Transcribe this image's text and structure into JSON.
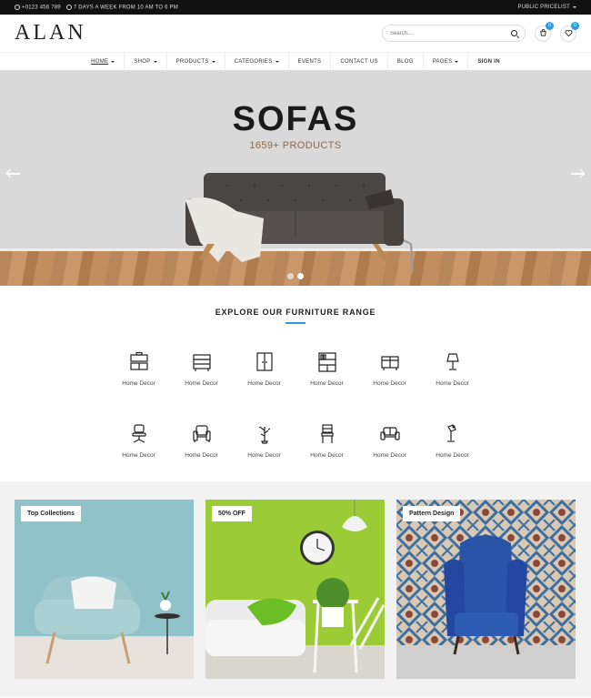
{
  "topbar": {
    "phone": "+0123 456 789",
    "hours": "7 DAYS A WEEK FROM 10 AM TO 6 PM",
    "pricelist": "PUBLIC PRICELIST"
  },
  "header": {
    "logo": "ALAN",
    "search_placeholder": "Search...",
    "cart_count": "0",
    "wishlist_count": "0"
  },
  "nav": {
    "items": [
      "HOME",
      "SHOP",
      "PRODUCTS",
      "CATEGORIES",
      "EVENTS",
      "CONTACT US",
      "BLOG",
      "PAGES",
      "SIGN IN"
    ]
  },
  "hero": {
    "title": "SOFAS",
    "subtitle": "1659+ PRODUCTS"
  },
  "range": {
    "title": "EXPLORE OUR FURNITURE RANGE",
    "categories": [
      {
        "label": "Home Decor",
        "icon": "tv-stand-icon"
      },
      {
        "label": "Home Decor",
        "icon": "drawer-cabinet-icon"
      },
      {
        "label": "Home Decor",
        "icon": "wardrobe-icon"
      },
      {
        "label": "Home Decor",
        "icon": "bookshelf-icon"
      },
      {
        "label": "Home Decor",
        "icon": "side-table-icon"
      },
      {
        "label": "Home Decor",
        "icon": "table-lamp-icon"
      },
      {
        "label": "Home Decor",
        "icon": "office-chair-icon"
      },
      {
        "label": "Home Decor",
        "icon": "armchair-icon"
      },
      {
        "label": "Home Decor",
        "icon": "plant-icon"
      },
      {
        "label": "Home Decor",
        "icon": "dining-chair-icon"
      },
      {
        "label": "Home Decor",
        "icon": "sofa-icon"
      },
      {
        "label": "Home Decor",
        "icon": "desk-lamp-icon"
      }
    ]
  },
  "promos": [
    {
      "tag": "Top Collections"
    },
    {
      "tag": "50% OFF"
    },
    {
      "tag": "Pattern Design"
    }
  ],
  "colors": {
    "accent": "#2d9cdb",
    "topbar": "#111111",
    "hero_bg": "#d9d9d9",
    "promo1_bg": "#8fc3c9",
    "promo2_bg": "#9ccc35",
    "promo3_chair": "#2a54a8"
  }
}
